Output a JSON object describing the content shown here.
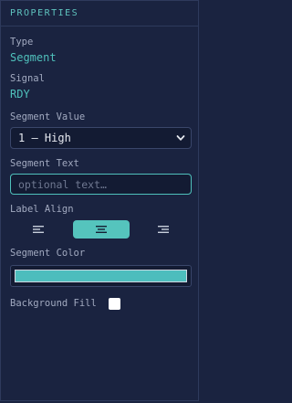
{
  "panel": {
    "title": "PROPERTIES",
    "type": {
      "label": "Type",
      "value": "Segment"
    },
    "signal": {
      "label": "Signal",
      "value": "RDY"
    },
    "segment_value": {
      "label": "Segment Value",
      "selected": "1 — High",
      "icon": "chevron-down-icon"
    },
    "segment_text": {
      "label": "Segment Text",
      "placeholder": "optional text…",
      "value": ""
    },
    "label_align": {
      "label": "Label Align",
      "options": [
        "align-left-icon",
        "align-center-icon",
        "align-right-icon"
      ],
      "selected": "center"
    },
    "segment_color": {
      "label": "Segment Color",
      "value": "#4dbdbd"
    },
    "background_fill": {
      "label": "Background Fill",
      "checked": false
    }
  },
  "colors": {
    "accent": "#4fc0bb",
    "background": "#1a2340"
  }
}
